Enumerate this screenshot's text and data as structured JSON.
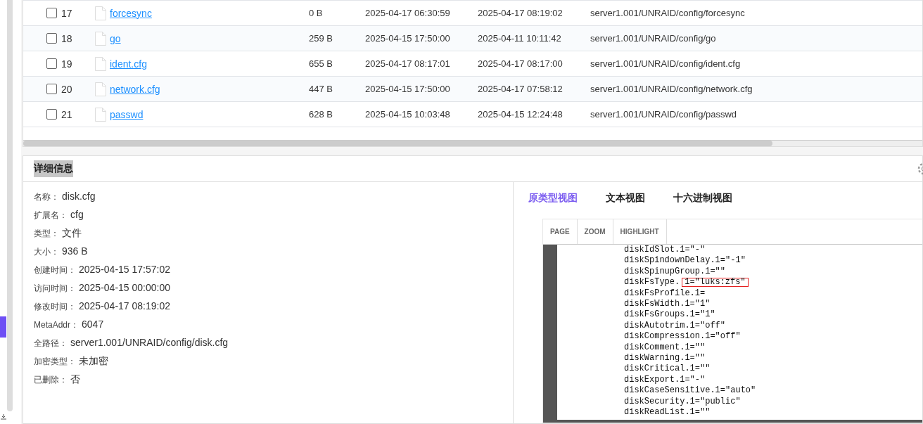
{
  "table": {
    "rows": [
      {
        "checked": false,
        "index": "17",
        "name": "forcesync",
        "size": "0 B",
        "time_1": "2025-04-17 06:30:59",
        "time_2": "2025-04-17 08:19:02",
        "path": "server1.001/UNRAID/config/forcesync"
      },
      {
        "checked": false,
        "index": "18",
        "name": "go",
        "size": "259 B",
        "time_1": "2025-04-15 17:50:00",
        "time_2": "2025-04-11 10:11:42",
        "path": "server1.001/UNRAID/config/go"
      },
      {
        "checked": false,
        "index": "19",
        "name": "ident.cfg",
        "size": "655 B",
        "time_1": "2025-04-17 08:17:01",
        "time_2": "2025-04-17 08:17:00",
        "path": "server1.001/UNRAID/config/ident.cfg"
      },
      {
        "checked": false,
        "index": "20",
        "name": "network.cfg",
        "size": "447 B",
        "time_1": "2025-04-15 17:50:00",
        "time_2": "2025-04-17 07:58:12",
        "path": "server1.001/UNRAID/config/network.cfg"
      },
      {
        "checked": false,
        "index": "21",
        "name": "passwd",
        "size": "628 B",
        "time_1": "2025-04-15 10:03:48",
        "time_2": "2025-04-15 12:24:48",
        "path": "server1.001/UNRAID/config/passwd"
      }
    ]
  },
  "details": {
    "title": "详细信息",
    "fields": [
      {
        "label": "名称：",
        "value": "disk.cfg"
      },
      {
        "label": "扩展名：",
        "value": "cfg"
      },
      {
        "label": "类型：",
        "value": "文件"
      },
      {
        "label": "大小：",
        "value": "936 B"
      },
      {
        "label": "创建时间：",
        "value": "2025-04-15 17:57:02"
      },
      {
        "label": "访问时间：",
        "value": "2025-04-15 00:00:00"
      },
      {
        "label": "修改时间：",
        "value": "2025-04-17 08:19:02"
      },
      {
        "label": "MetaAddr：",
        "value": "6047"
      },
      {
        "label": "全路径：",
        "value": "server1.001/UNRAID/config/disk.cfg"
      },
      {
        "label": "加密类型：",
        "value": "未加密"
      },
      {
        "label": "已删除：",
        "value": "否"
      }
    ]
  },
  "view_tabs": [
    {
      "label": "原类型视图",
      "selected": true
    },
    {
      "label": "文本视图",
      "selected": false
    },
    {
      "label": "十六进制视图",
      "selected": false
    }
  ],
  "viewer": {
    "toolbar": [
      "PAGE",
      "ZOOM",
      "HIGHLIGHT"
    ],
    "lines": [
      {
        "text": "diskIdSlot.1=\"-\""
      },
      {
        "text": "diskSpindownDelay.1=\"-1\""
      },
      {
        "text": "diskSpinupGroup.1=\"\""
      },
      {
        "text": "diskFsType.",
        "marked": "1=\"luks:zfs\""
      },
      {
        "text": "diskFsProfile.1="
      },
      {
        "text": "diskFsWidth.1=\"1\""
      },
      {
        "text": "diskFsGroups.1=\"1\""
      },
      {
        "text": "diskAutotrim.1=\"off\""
      },
      {
        "text": "diskCompression.1=\"off\""
      },
      {
        "text": "diskComment.1=\"\""
      },
      {
        "text": "diskWarning.1=\"\""
      },
      {
        "text": "diskCritical.1=\"\""
      },
      {
        "text": "diskExport.1=\"-\""
      },
      {
        "text": "diskCaseSensitive.1=\"auto\""
      },
      {
        "text": "diskSecurity.1=\"public\""
      },
      {
        "text": "diskReadList.1=\"\""
      }
    ]
  }
}
